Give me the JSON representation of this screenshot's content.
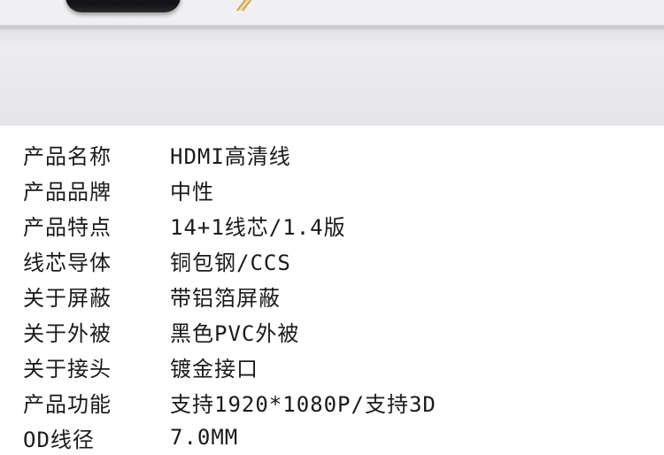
{
  "specs": [
    {
      "label": "产品名称",
      "value": "HDMI高清线"
    },
    {
      "label": "产品品牌",
      "value": "中性"
    },
    {
      "label": "产品特点",
      "value": "14+1线芯/1.4版"
    },
    {
      "label": "线芯导体",
      "value": "铜包钢/CCS"
    },
    {
      "label": "关于屏蔽",
      "value": "带铝箔屏蔽"
    },
    {
      "label": "关于外被",
      "value": "黑色PVC外被"
    },
    {
      "label": "关于接头",
      "value": "镀金接口"
    },
    {
      "label": "产品功能",
      "value": "支持1920*1080P/支持3D"
    },
    {
      "label": "OD线径",
      "value": "7.0MM"
    }
  ]
}
